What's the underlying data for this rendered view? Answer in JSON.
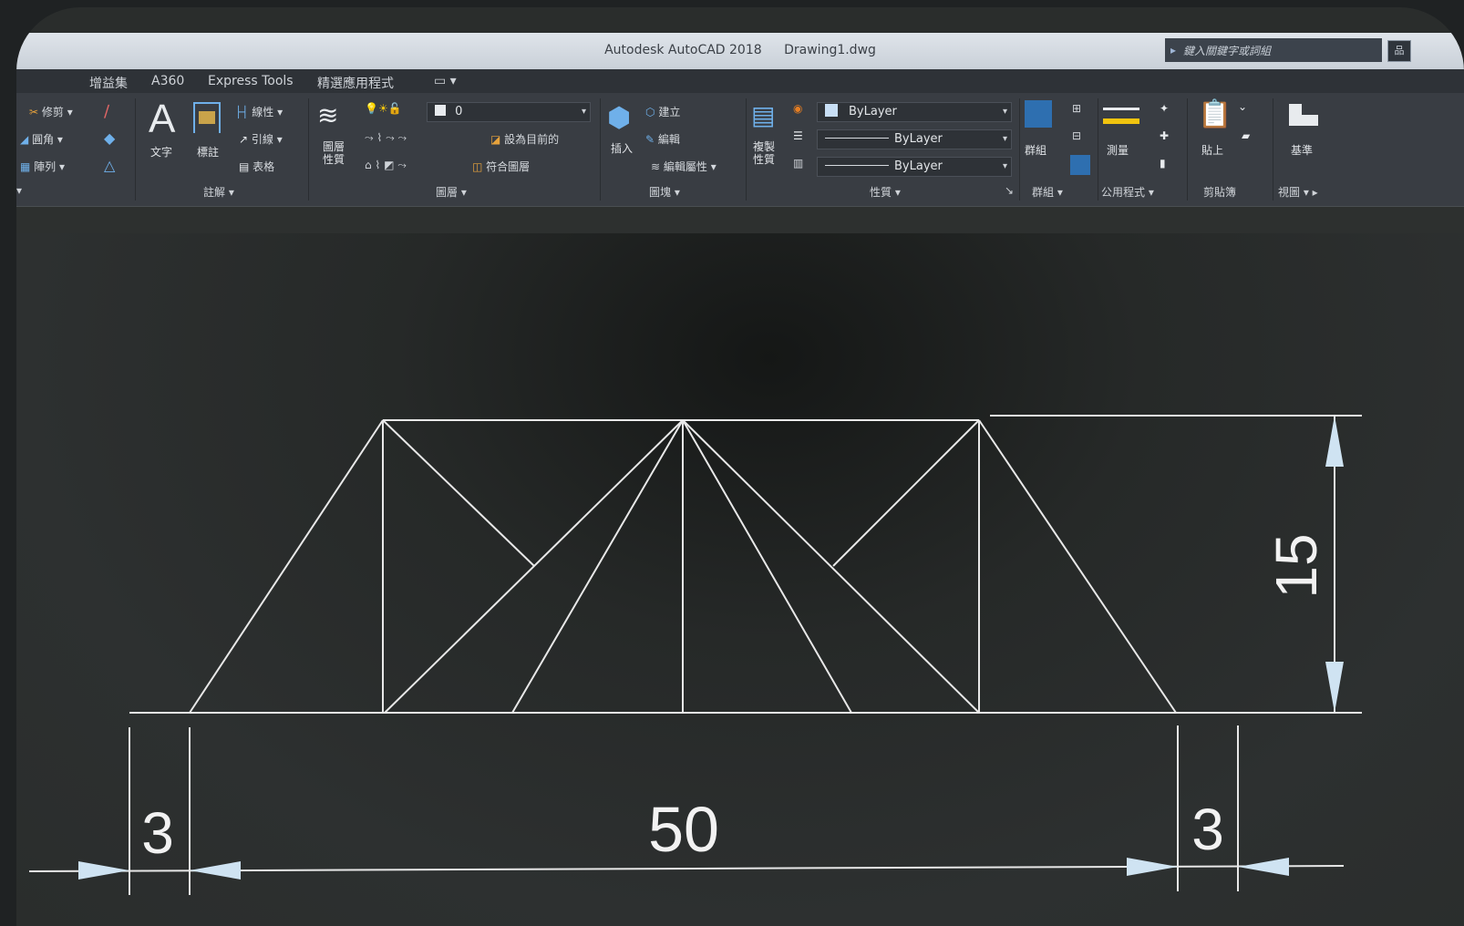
{
  "titlebar": {
    "app": "Autodesk AutoCAD 2018",
    "file": "Drawing1.dwg",
    "search_placeholder": "鍵入關鍵字或詞組",
    "help": "品"
  },
  "tabs": [
    "增益集",
    "A360",
    "Express Tools",
    "精選應用程式",
    "▭ ▾"
  ],
  "ribbon": {
    "modify": {
      "trim": "修剪 ▾",
      "fillet": "圓角 ▾",
      "array": "陣列 ▾"
    },
    "annotation": {
      "text": "文字",
      "dimension": "標註",
      "linear": "線性 ▾",
      "leader": "引線 ▾",
      "table": "表格",
      "panel": "註解 ▾"
    },
    "layers": {
      "layer_props": "圖層\n性質",
      "current_layer": "0",
      "set_current": "設為目前的",
      "match_layer": "符合圖層",
      "panel": "圖層 ▾"
    },
    "block": {
      "insert": "插入",
      "create": "建立",
      "edit": "編輯",
      "edit_attr": "編輯屬性 ▾",
      "panel": "圖塊 ▾"
    },
    "properties": {
      "match": "複製\n性質",
      "color": "ByLayer",
      "linetype": "ByLayer",
      "lineweight": "ByLayer",
      "panel": "性質 ▾"
    },
    "groups": {
      "group": "群組",
      "panel": "群組 ▾"
    },
    "utilities": {
      "measure": "測量",
      "panel": "公用程式 ▾"
    },
    "clipboard": {
      "paste": "貼上",
      "panel": "剪貼簿"
    },
    "view": {
      "base": "基準",
      "panel": "視圖 ▾ ▸"
    }
  },
  "drawing": {
    "dim_left": "3",
    "dim_span": "50",
    "dim_right": "3",
    "dim_height": "15"
  },
  "colors": {
    "canvas": "#2a2d2c",
    "lines": "#e8e8e8",
    "ribbon": "#393d43",
    "titlebar": "#d6dce3"
  }
}
